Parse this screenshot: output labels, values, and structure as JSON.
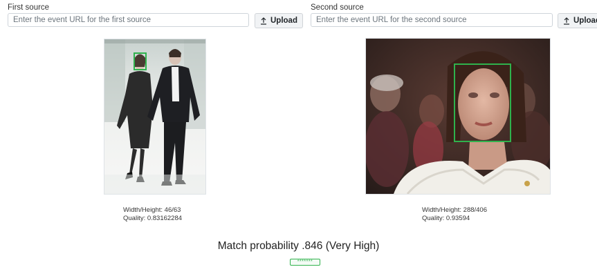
{
  "first_source": {
    "label": "First source",
    "url_placeholder": "Enter the event URL for the first source",
    "url_value": "",
    "upload_label": "Upload",
    "upload_icon": "upload-icon",
    "image_info": {
      "width_height": "Width/Height: 46/63",
      "quality": "Quality: 0.83162284"
    }
  },
  "second_source": {
    "label": "Second source",
    "url_placeholder": "Enter the event URL for the second source",
    "url_value": "",
    "upload_label": "Upload",
    "upload_icon": "upload-icon",
    "image_info": {
      "width_height": "Width/Height: 288/406",
      "quality": "Quality: 0.93594"
    }
  },
  "result": {
    "match_text": "Match probability .846 (Very High)",
    "rating_badge": "*******"
  },
  "colors": {
    "face_box": "#2fb24c",
    "text": "#212529",
    "input_border": "#ced4da"
  }
}
